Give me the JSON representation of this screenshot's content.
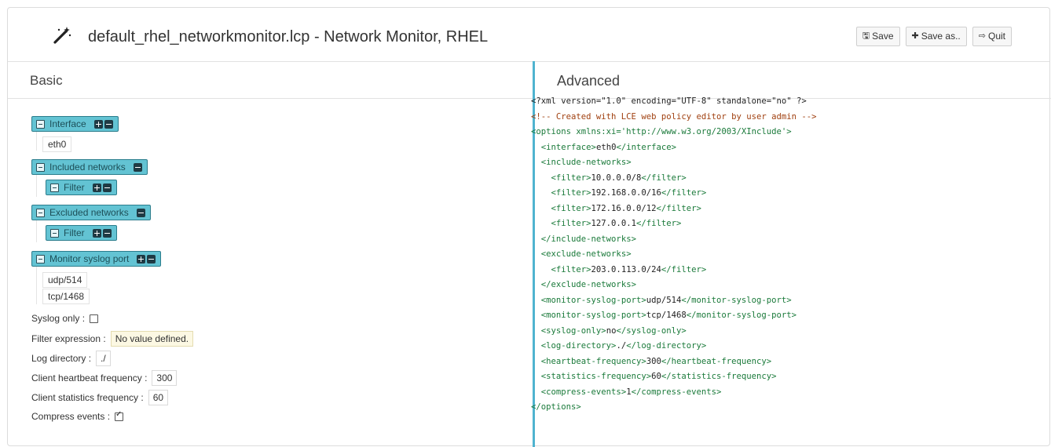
{
  "header": {
    "title": "default_rhel_networkmonitor.lcp - Network Monitor, RHEL",
    "buttons": {
      "save": "Save",
      "save_as": "Save as..",
      "quit": "Quit"
    }
  },
  "basic": {
    "heading": "Basic",
    "interface_label": "Interface",
    "interface_value": "eth0",
    "included_label": "Included networks",
    "included_filter": "Filter",
    "excluded_label": "Excluded networks",
    "excluded_filter": "Filter",
    "syslog_label": "Monitor syslog port",
    "syslog_ports": [
      "udp/514",
      "tcp/1468"
    ],
    "fields": {
      "syslog_only_label": "Syslog only :",
      "syslog_only_checked": false,
      "filter_expr_label": "Filter expression :",
      "filter_expr_value": "No value defined.",
      "log_dir_label": "Log directory :",
      "log_dir_value": "./",
      "heartbeat_label": "Client heartbeat frequency :",
      "heartbeat_value": "300",
      "stats_label": "Client statistics frequency :",
      "stats_value": "60",
      "compress_label": "Compress events :",
      "compress_checked": true
    }
  },
  "advanced": {
    "heading": "Advanced",
    "lines": [
      "<?xml version=\"1.0\" encoding=\"UTF-8\" standalone=\"no\" ?>",
      "<!-- Created with LCE web policy editor by user admin -->",
      "<options xmlns:xi='http://www.w3.org/2003/XInclude'>",
      "  <interface>eth0</interface>",
      "  <include-networks>",
      "    <filter>10.0.0.0/8</filter>",
      "    <filter>192.168.0.0/16</filter>",
      "    <filter>172.16.0.0/12</filter>",
      "    <filter>127.0.0.1</filter>",
      "  </include-networks>",
      "  <exclude-networks>",
      "    <filter>203.0.113.0/24</filter>",
      "  </exclude-networks>",
      "  <monitor-syslog-port>udp/514</monitor-syslog-port>",
      "  <monitor-syslog-port>tcp/1468</monitor-syslog-port>",
      "  <syslog-only>no</syslog-only>",
      "  <log-directory>./</log-directory>",
      "  <heartbeat-frequency>300</heartbeat-frequency>",
      "  <statistics-frequency>60</statistics-frequency>",
      "  <compress-events>1</compress-events>",
      "</options>"
    ]
  }
}
